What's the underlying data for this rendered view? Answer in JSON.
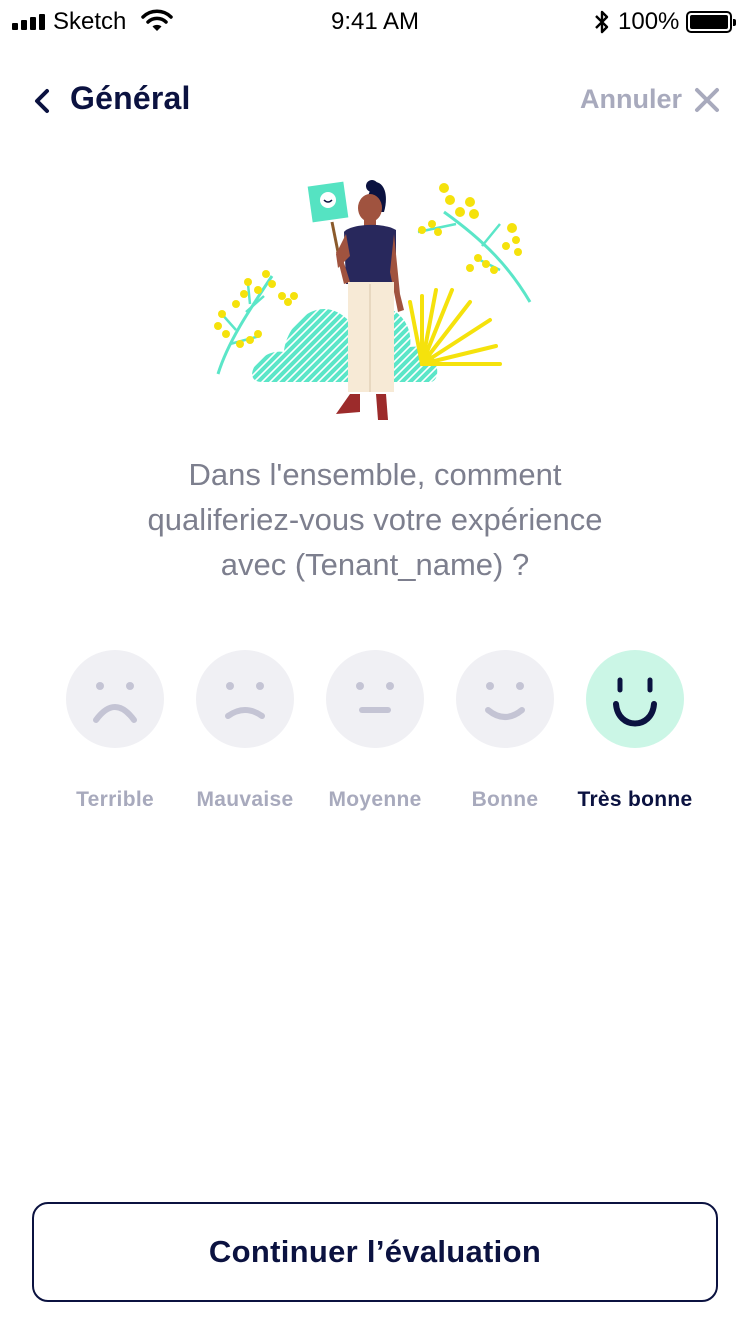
{
  "status_bar": {
    "carrier": "Sketch",
    "time": "9:41 AM",
    "battery": "100%",
    "icons": [
      "signal-icon",
      "wifi-icon",
      "bluetooth-icon",
      "battery-icon"
    ]
  },
  "nav": {
    "title": "Général",
    "cancel_label": "Annuler",
    "back_icon": "chevron-left-icon",
    "close_icon": "close-icon"
  },
  "question": {
    "line1": "Dans l'ensemble, comment",
    "line2": "qualiferiez-vous votre expérience",
    "line3": "avec (Tenant_name) ?"
  },
  "ratings": {
    "selected": "Très bonne",
    "options": [
      {
        "label": "Terrible",
        "icon": "very-sad-face-icon"
      },
      {
        "label": "Mauvaise",
        "icon": "sad-face-icon"
      },
      {
        "label": "Moyenne",
        "icon": "neutral-face-icon"
      },
      {
        "label": "Bonne",
        "icon": "smile-face-icon"
      },
      {
        "label": "Très bonne",
        "icon": "big-smile-face-icon"
      }
    ]
  },
  "continue_button": {
    "label": "Continuer l’évaluation"
  },
  "colors": {
    "primary": "#0b1240",
    "muted": "#a8aabd",
    "text_gray": "#7d7f8e",
    "face_inactive": "#f0f0f4",
    "face_active": "#cbf6e6",
    "mint": "#5be6c8",
    "yellow": "#f5e20c",
    "sign": "#55e3c2"
  }
}
